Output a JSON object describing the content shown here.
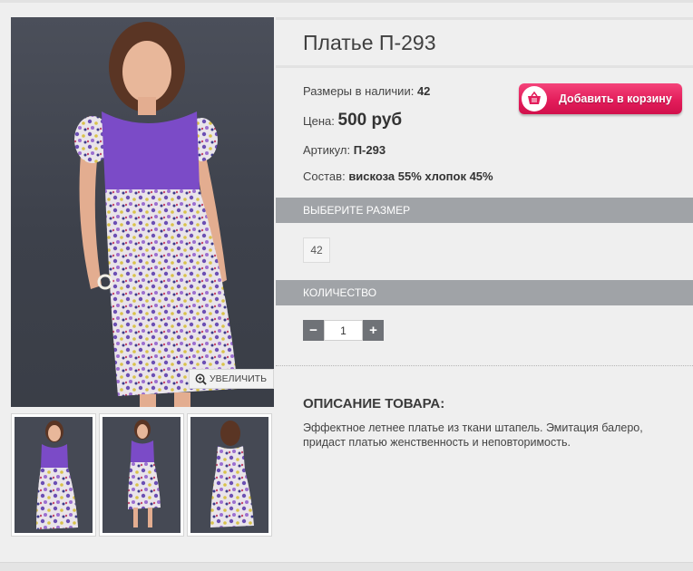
{
  "product": {
    "title": "Платье П-293",
    "sizes_label": "Размеры в наличии:",
    "sizes_value": "42",
    "price_label": "Цена:",
    "price_value": "500 руб",
    "article_label": "Артикул:",
    "article_value": "П-293",
    "composition_label": "Состав:",
    "composition_value": "вискоза 55% хлопок 45%"
  },
  "gallery": {
    "zoom_label": "УВЕЛИЧИТЬ"
  },
  "cart": {
    "add_label": "Добавить в корзину",
    "accent_color": "#e31d5b"
  },
  "size_section": {
    "header": "ВЫБЕРИТЕ РАЗМЕР",
    "options": [
      "42"
    ]
  },
  "quantity_section": {
    "header": "КОЛИЧЕСТВО",
    "value": "1",
    "minus": "−",
    "plus": "+"
  },
  "description": {
    "header": "ОПИСАНИЕ ТОВАРА:",
    "text": "Эффектное летнее платье из ткани штапель. Эмитация балеро, придаст платью женственность и неповторимость."
  }
}
